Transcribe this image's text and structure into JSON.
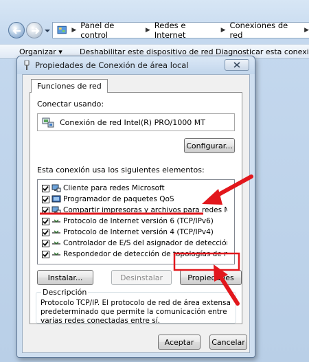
{
  "explorer": {
    "breadcrumbs": [
      "Panel de control",
      "Redes e Internet",
      "Conexiones de red"
    ],
    "toolbar": {
      "organize": "Organizar ▾",
      "disable": "Deshabilitar este dispositivo de red",
      "diagnose": "Diagnosticar esta conexión"
    }
  },
  "dialog": {
    "title": "Propiedades de Conexión de área local",
    "tab": "Funciones de red",
    "connect_using_label": "Conectar usando:",
    "adapter_name": "Conexión de red Intel(R) PRO/1000 MT",
    "configure_button": "Configurar...",
    "items_label": "Esta conexión usa los siguientes elementos:",
    "items": [
      {
        "label": "Cliente para redes Microsoft",
        "checked": true,
        "icon": "network-client-icon"
      },
      {
        "label": "Programador de paquetes QoS",
        "checked": true,
        "icon": "service-icon"
      },
      {
        "label": "Compartir impresoras y archivos para redes Microsoft",
        "checked": true,
        "icon": "network-client-icon"
      },
      {
        "label": "Protocolo de Internet versión 6 (TCP/IPv6)",
        "checked": true,
        "icon": "protocol-icon"
      },
      {
        "label": "Protocolo de Internet versión 4 (TCP/IPv4)",
        "checked": true,
        "icon": "protocol-icon"
      },
      {
        "label": "Controlador de E/S del asignador de detección de topol...",
        "checked": true,
        "icon": "protocol-icon"
      },
      {
        "label": "Respondedor de detección de topologías de nivel de v...",
        "checked": true,
        "icon": "protocol-icon"
      }
    ],
    "install_button": "Instalar...",
    "uninstall_button": "Desinstalar",
    "properties_button": "Propiedades",
    "description_legend": "Descripción",
    "description_text": "Protocolo TCP/IP. El protocolo de red de área extensa predeterminado que permite la comunicación entre varias redes conectadas entre sí.",
    "accept_button": "Aceptar",
    "cancel_button": "Cancelar"
  },
  "colors": {
    "annotation_red": "#e2171c",
    "window_frame": "#cfdff0"
  }
}
